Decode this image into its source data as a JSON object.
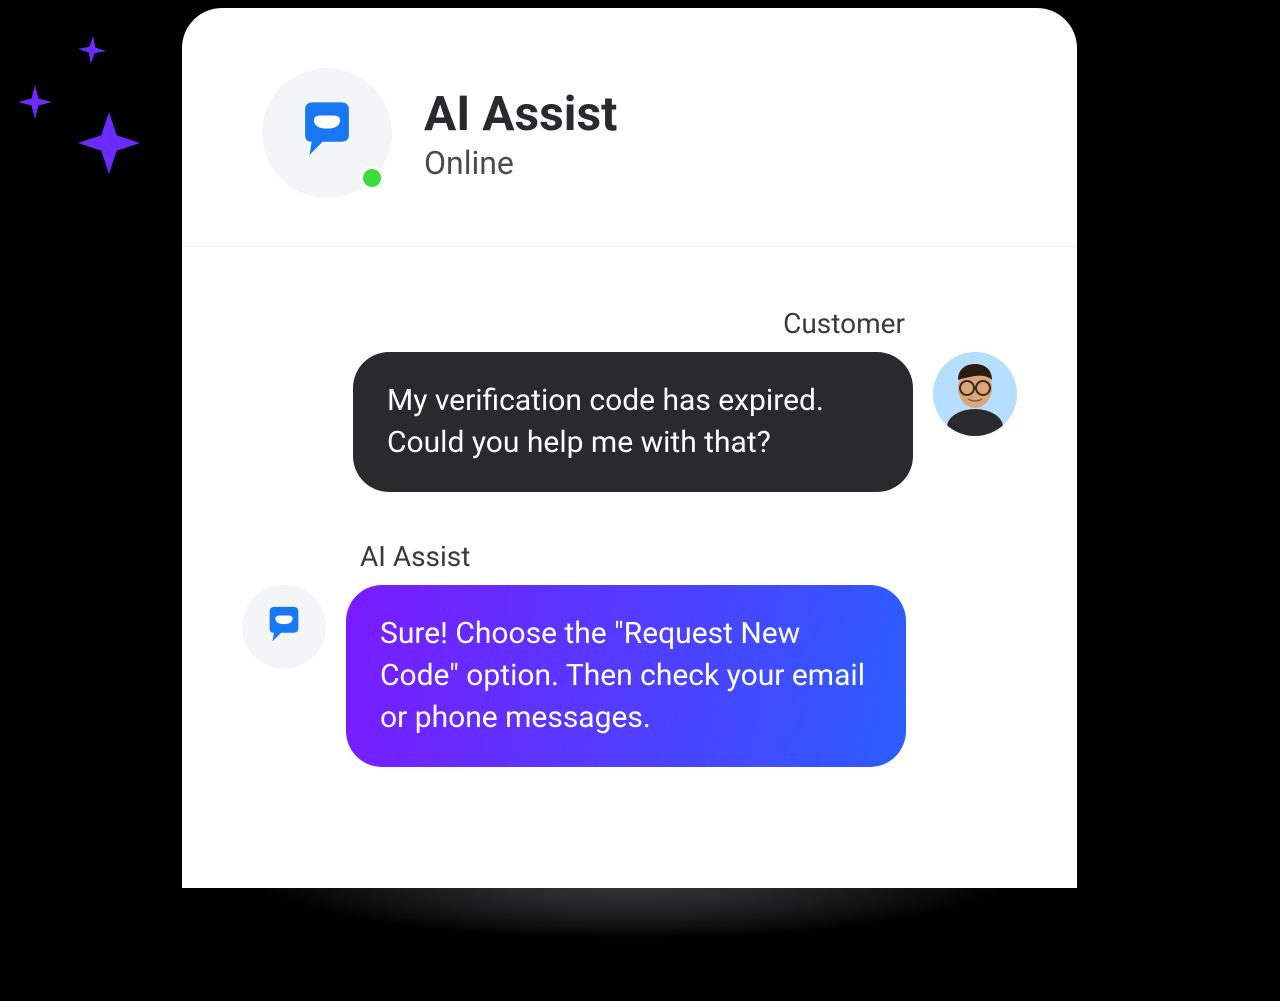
{
  "header": {
    "title": "AI Assist",
    "status": "Online"
  },
  "messages": {
    "customer": {
      "sender_label": "Customer",
      "text": "My verification code has expired. Could you help me with that?"
    },
    "bot": {
      "sender_label": "AI Assist",
      "text": "Sure! Choose the \"Request New Code\" option. Then check your email or phone messages."
    }
  },
  "icons": {
    "chatbot": "chatbot-icon",
    "status": "online-status-dot",
    "customer_avatar": "customer-avatar",
    "sparkle": "sparkle-icon"
  },
  "colors": {
    "accent_purple": "#6B2BFF",
    "bubble_dark": "#2a2a2e",
    "bubble_gradient_start": "#7A1BFF",
    "bubble_gradient_end": "#2B5DFF",
    "online_green": "#3BDC3B"
  }
}
